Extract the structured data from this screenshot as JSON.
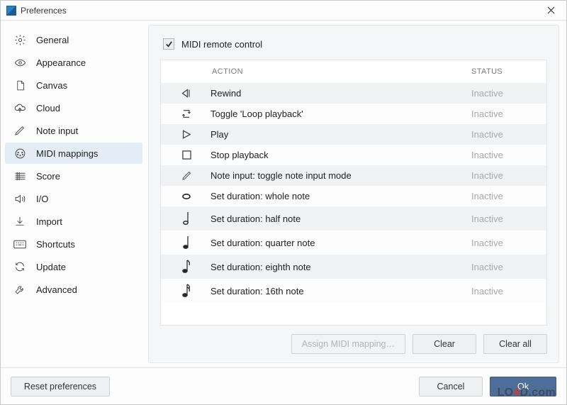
{
  "window": {
    "title": "Preferences"
  },
  "sidebar": {
    "items": [
      {
        "id": "general",
        "label": "General"
      },
      {
        "id": "appearance",
        "label": "Appearance"
      },
      {
        "id": "canvas",
        "label": "Canvas"
      },
      {
        "id": "cloud",
        "label": "Cloud"
      },
      {
        "id": "noteinput",
        "label": "Note input"
      },
      {
        "id": "midimappings",
        "label": "MIDI mappings"
      },
      {
        "id": "score",
        "label": "Score"
      },
      {
        "id": "io",
        "label": "I/O"
      },
      {
        "id": "import",
        "label": "Import"
      },
      {
        "id": "shortcuts",
        "label": "Shortcuts"
      },
      {
        "id": "update",
        "label": "Update"
      },
      {
        "id": "advanced",
        "label": "Advanced"
      }
    ],
    "active_index": 5
  },
  "content": {
    "checkbox": {
      "label": "MIDI remote control",
      "checked": true
    },
    "headers": {
      "action": "ACTION",
      "status": "STATUS"
    },
    "rows": [
      {
        "icon": "rewind",
        "name": "Rewind",
        "status": "Inactive"
      },
      {
        "icon": "loop",
        "name": "Toggle 'Loop playback'",
        "status": "Inactive"
      },
      {
        "icon": "play",
        "name": "Play",
        "status": "Inactive"
      },
      {
        "icon": "stop",
        "name": "Stop playback",
        "status": "Inactive"
      },
      {
        "icon": "pencil",
        "name": "Note input: toggle note input mode",
        "status": "Inactive"
      },
      {
        "icon": "whole",
        "name": "Set duration: whole note",
        "status": "Inactive"
      },
      {
        "icon": "half",
        "name": "Set duration: half note",
        "status": "Inactive"
      },
      {
        "icon": "quarter",
        "name": "Set duration: quarter note",
        "status": "Inactive"
      },
      {
        "icon": "eighth",
        "name": "Set duration: eighth note",
        "status": "Inactive"
      },
      {
        "icon": "sixteenth",
        "name": "Set duration: 16th note",
        "status": "Inactive"
      }
    ],
    "buttons": {
      "assign": "Assign MIDI mapping…",
      "clear": "Clear",
      "clear_all": "Clear all"
    }
  },
  "footer": {
    "reset": "Reset preferences",
    "cancel": "Cancel",
    "ok": "Ok"
  },
  "watermark": {
    "prefix": "LO",
    "accent": "4",
    "suffix": "D.com"
  }
}
